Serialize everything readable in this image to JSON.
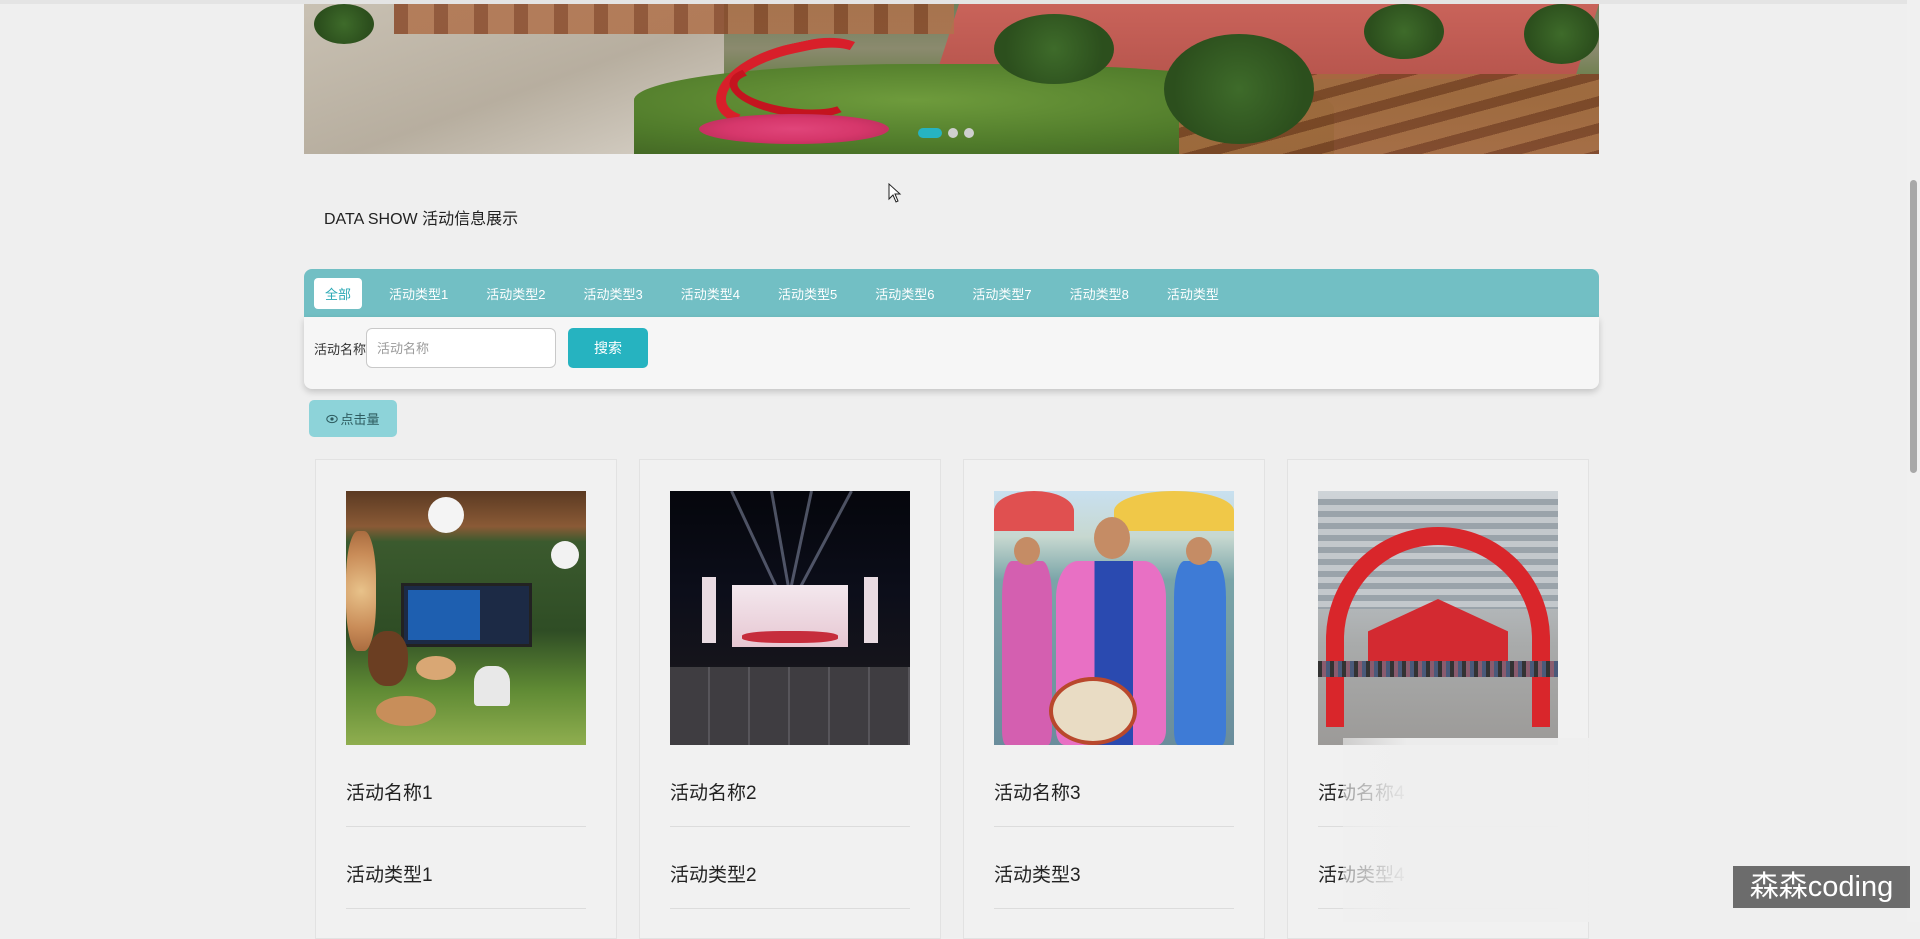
{
  "carousel": {
    "slide_count": 3,
    "active_slide": 1
  },
  "section": {
    "title": "DATA SHOW 活动信息展示"
  },
  "categories": [
    {
      "label": "全部",
      "active": true
    },
    {
      "label": "活动类型1",
      "active": false
    },
    {
      "label": "活动类型2",
      "active": false
    },
    {
      "label": "活动类型3",
      "active": false
    },
    {
      "label": "活动类型4",
      "active": false
    },
    {
      "label": "活动类型5",
      "active": false
    },
    {
      "label": "活动类型6",
      "active": false
    },
    {
      "label": "活动类型7",
      "active": false
    },
    {
      "label": "活动类型8",
      "active": false
    },
    {
      "label": "活动类型",
      "active": false
    }
  ],
  "search": {
    "label": "活动名称",
    "placeholder": "活动名称",
    "value": "",
    "button_label": "搜索"
  },
  "sort": {
    "icon": "eye-icon",
    "label": "点击量"
  },
  "activities": [
    {
      "name": "活动名称1",
      "type": "活动类型1"
    },
    {
      "name": "活动名称2",
      "type": "活动类型2"
    },
    {
      "name": "活动名称3",
      "type": "活动类型3"
    },
    {
      "name": "活动名称4",
      "type": "活动类型4"
    }
  ],
  "watermark": "森森coding",
  "colors": {
    "accent": "#26b3c0",
    "tab_bar": "#72bfc4",
    "sort_button": "#8dd3d9"
  }
}
